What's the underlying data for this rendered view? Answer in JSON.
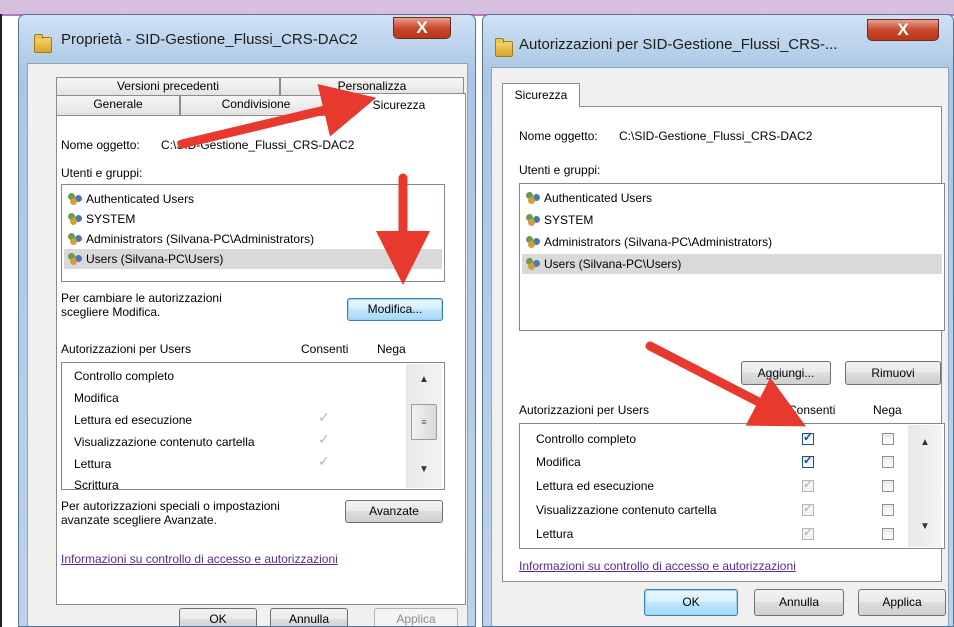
{
  "left_window": {
    "title": "Proprietà - SID-Gestione_Flussi_CRS-DAC2",
    "close": "X",
    "tabs_row1": [
      "Versioni precedenti",
      "Personalizza"
    ],
    "tabs_row2": [
      "Generale",
      "Condivisione",
      "Sicurezza"
    ],
    "object_label": "Nome oggetto:",
    "object_value": "C:\\SID-Gestione_Flussi_CRS-DAC2",
    "users_label": "Utenti e gruppi:",
    "users": [
      "Authenticated Users",
      "SYSTEM",
      "Administrators (Silvana-PC\\Administrators)",
      "Users (Silvana-PC\\Users)"
    ],
    "change_text_1": "Per cambiare le autorizzazioni",
    "change_text_2": "scegliere Modifica.",
    "modify_button": "Modifica...",
    "perms_label": "Autorizzazioni per Users",
    "allow_header": "Consenti",
    "deny_header": "Nega",
    "permissions": [
      "Controllo completo",
      "Modifica",
      "Lettura ed esecuzione",
      "Visualizzazione contenuto cartella",
      "Lettura",
      "Scrittura"
    ],
    "special_text_1": "Per autorizzazioni speciali o impostazioni",
    "special_text_2": "avanzate scegliere Avanzate.",
    "advanced_button": "Avanzate",
    "info_link": "Informazioni su controllo di accesso e autorizzazioni",
    "ok": "OK",
    "cancel": "Annulla",
    "apply": "Applica"
  },
  "right_window": {
    "title": "Autorizzazioni per SID-Gestione_Flussi_CRS-...",
    "close": "X",
    "tab": "Sicurezza",
    "object_label": "Nome oggetto:",
    "object_value": "C:\\SID-Gestione_Flussi_CRS-DAC2",
    "users_label": "Utenti e gruppi:",
    "users": [
      "Authenticated Users",
      "SYSTEM",
      "Administrators (Silvana-PC\\Administrators)",
      "Users (Silvana-PC\\Users)"
    ],
    "add_button": "Aggiungi...",
    "remove_button": "Rimuovi",
    "perms_label": "Autorizzazioni per Users",
    "allow_header": "Consenti",
    "deny_header": "Nega",
    "permissions": [
      "Controllo completo",
      "Modifica",
      "Lettura ed esecuzione",
      "Visualizzazione contenuto cartella",
      "Lettura"
    ],
    "allow_checked": [
      true,
      true,
      true,
      true,
      true
    ],
    "allow_inherited": [
      false,
      false,
      true,
      true,
      true
    ],
    "info_link": "Informazioni su controllo di accesso e autorizzazioni",
    "ok": "OK",
    "cancel": "Annulla",
    "apply": "Applica"
  },
  "colors": {
    "arrow": "#e8392f",
    "link": "#5a2a91",
    "selection": "#d9d9d9"
  }
}
